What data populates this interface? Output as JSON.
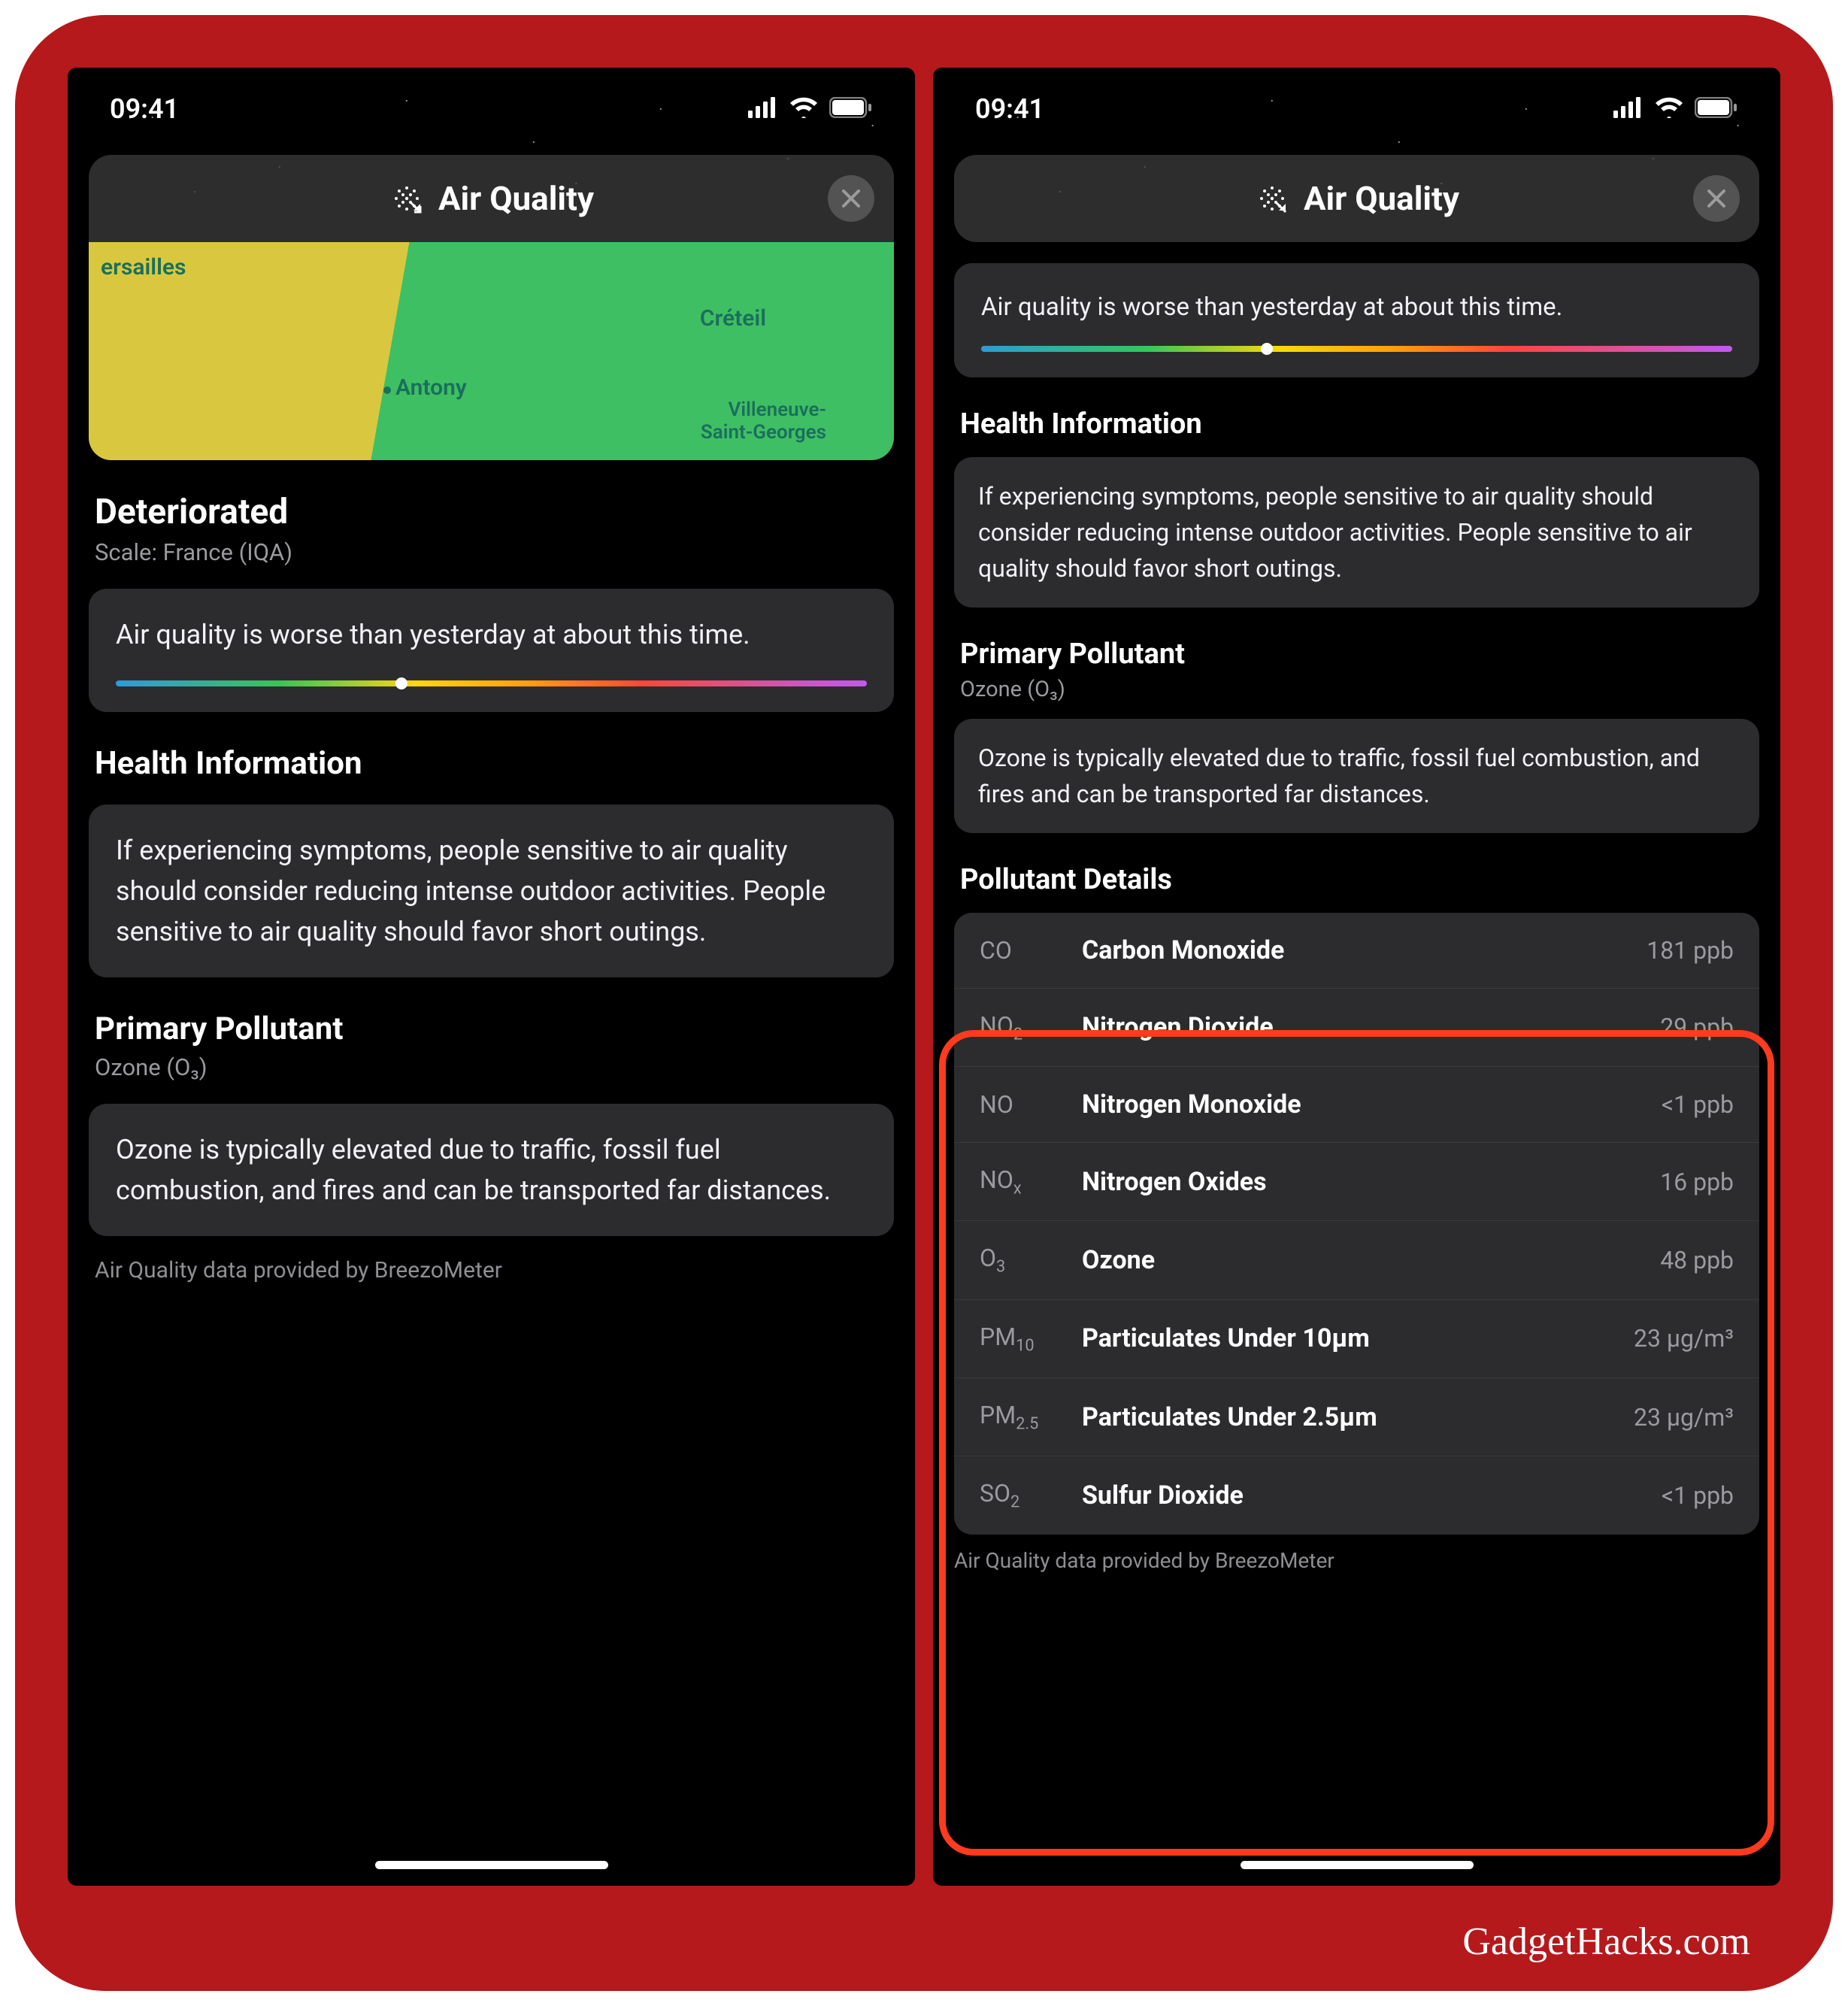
{
  "status": {
    "time": "09:41"
  },
  "watermark": "GadgetHacks.com",
  "sheet": {
    "title": "Air Quality",
    "close_aria": "Close"
  },
  "left": {
    "map": {
      "versailles": "ersailles",
      "creteil": "Créteil",
      "antony": "Antony",
      "vsg": "Villeneuve-\nSaint-Georges"
    },
    "status_heading": "Deteriorated",
    "scale_sub": "Scale: France (IQA)",
    "summary": "Air quality is worse than yesterday at about this time.",
    "marker_pct": 38,
    "health_heading": "Health Information",
    "health_body": "If experiencing symptoms, people sensitive to air quality should consider reducing intense outdoor activities. People sensitive to air quality should favor short outings.",
    "primary_heading": "Primary Pollutant",
    "primary_sub": "Ozone (O₃)",
    "primary_body": "Ozone is typically elevated due to traffic, fossil fuel combustion, and fires and can be transported far distances.",
    "attribution": "Air Quality data provided by BreezoMeter"
  },
  "right": {
    "summary": "Air quality is worse than yesterday at about this time.",
    "marker_pct": 38,
    "health_heading": "Health Information",
    "health_body": "If experiencing symptoms, people sensitive to air quality should consider reducing intense outdoor activities. People sensitive to air quality should favor short outings.",
    "primary_heading": "Primary Pollutant",
    "primary_sub": "Ozone (O₃)",
    "primary_body": "Ozone is typically elevated due to traffic, fossil fuel combustion, and fires and can be transported far distances.",
    "pollutant_heading": "Pollutant Details",
    "pollutants": [
      {
        "sym": "CO",
        "sub": "",
        "name": "Carbon Monoxide",
        "val": "181 ppb"
      },
      {
        "sym": "NO",
        "sub": "2",
        "name": "Nitrogen Dioxide",
        "val": "29 ppb"
      },
      {
        "sym": "NO",
        "sub": "",
        "name": "Nitrogen Monoxide",
        "val": "<1 ppb"
      },
      {
        "sym": "NO",
        "sub": "x",
        "name": "Nitrogen Oxides",
        "val": "16 ppb"
      },
      {
        "sym": "O",
        "sub": "3",
        "name": "Ozone",
        "val": "48 ppb"
      },
      {
        "sym": "PM",
        "sub": "10",
        "name": "Particulates Under 10µm",
        "val": "23 µg/m³"
      },
      {
        "sym": "PM",
        "sub": "2.5",
        "name": "Particulates Under 2.5µm",
        "val": "23 µg/m³"
      },
      {
        "sym": "SO",
        "sub": "2",
        "name": "Sulfur Dioxide",
        "val": "<1 ppb"
      }
    ],
    "attribution": "Air Quality data provided by BreezoMeter"
  }
}
